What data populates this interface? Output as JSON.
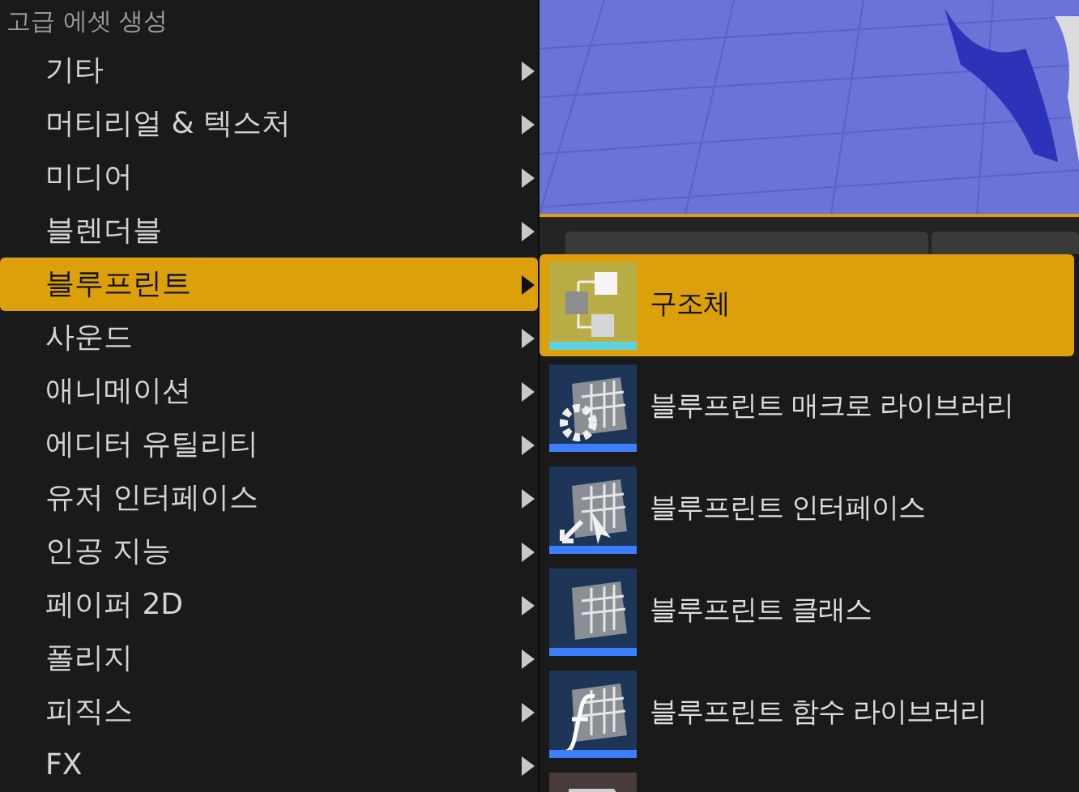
{
  "menu": {
    "header": "고급 에셋 생성",
    "items": [
      {
        "label": "기타",
        "selected": false
      },
      {
        "label": "머티리얼 & 텍스처",
        "selected": false
      },
      {
        "label": "미디어",
        "selected": false
      },
      {
        "label": "블렌더블",
        "selected": false
      },
      {
        "label": "블루프린트",
        "selected": true
      },
      {
        "label": "사운드",
        "selected": false
      },
      {
        "label": "애니메이션",
        "selected": false
      },
      {
        "label": "에디터 유틸리티",
        "selected": false
      },
      {
        "label": "유저 인터페이스",
        "selected": false
      },
      {
        "label": "인공 지능",
        "selected": false
      },
      {
        "label": "페이퍼 2D",
        "selected": false
      },
      {
        "label": "폴리지",
        "selected": false
      },
      {
        "label": "피직스",
        "selected": false
      },
      {
        "label": "FX",
        "selected": false
      }
    ]
  },
  "submenu": {
    "items": [
      {
        "kind": "struct",
        "label": "구조체",
        "selected": true,
        "color": "#5fd3e0"
      },
      {
        "kind": "macro",
        "label": "블루프린트 매크로 라이브러리",
        "selected": false,
        "color": "#3d7eff"
      },
      {
        "kind": "interface",
        "label": "블루프린트 인터페이스",
        "selected": false,
        "color": "#3d7eff"
      },
      {
        "kind": "class",
        "label": "블루프린트 클래스",
        "selected": false,
        "color": "#3d7eff"
      },
      {
        "kind": "function",
        "label": "블루프린트 함수 라이브러리",
        "selected": false,
        "color": "#3d7eff"
      },
      {
        "kind": "document",
        "selected": false
      }
    ]
  }
}
